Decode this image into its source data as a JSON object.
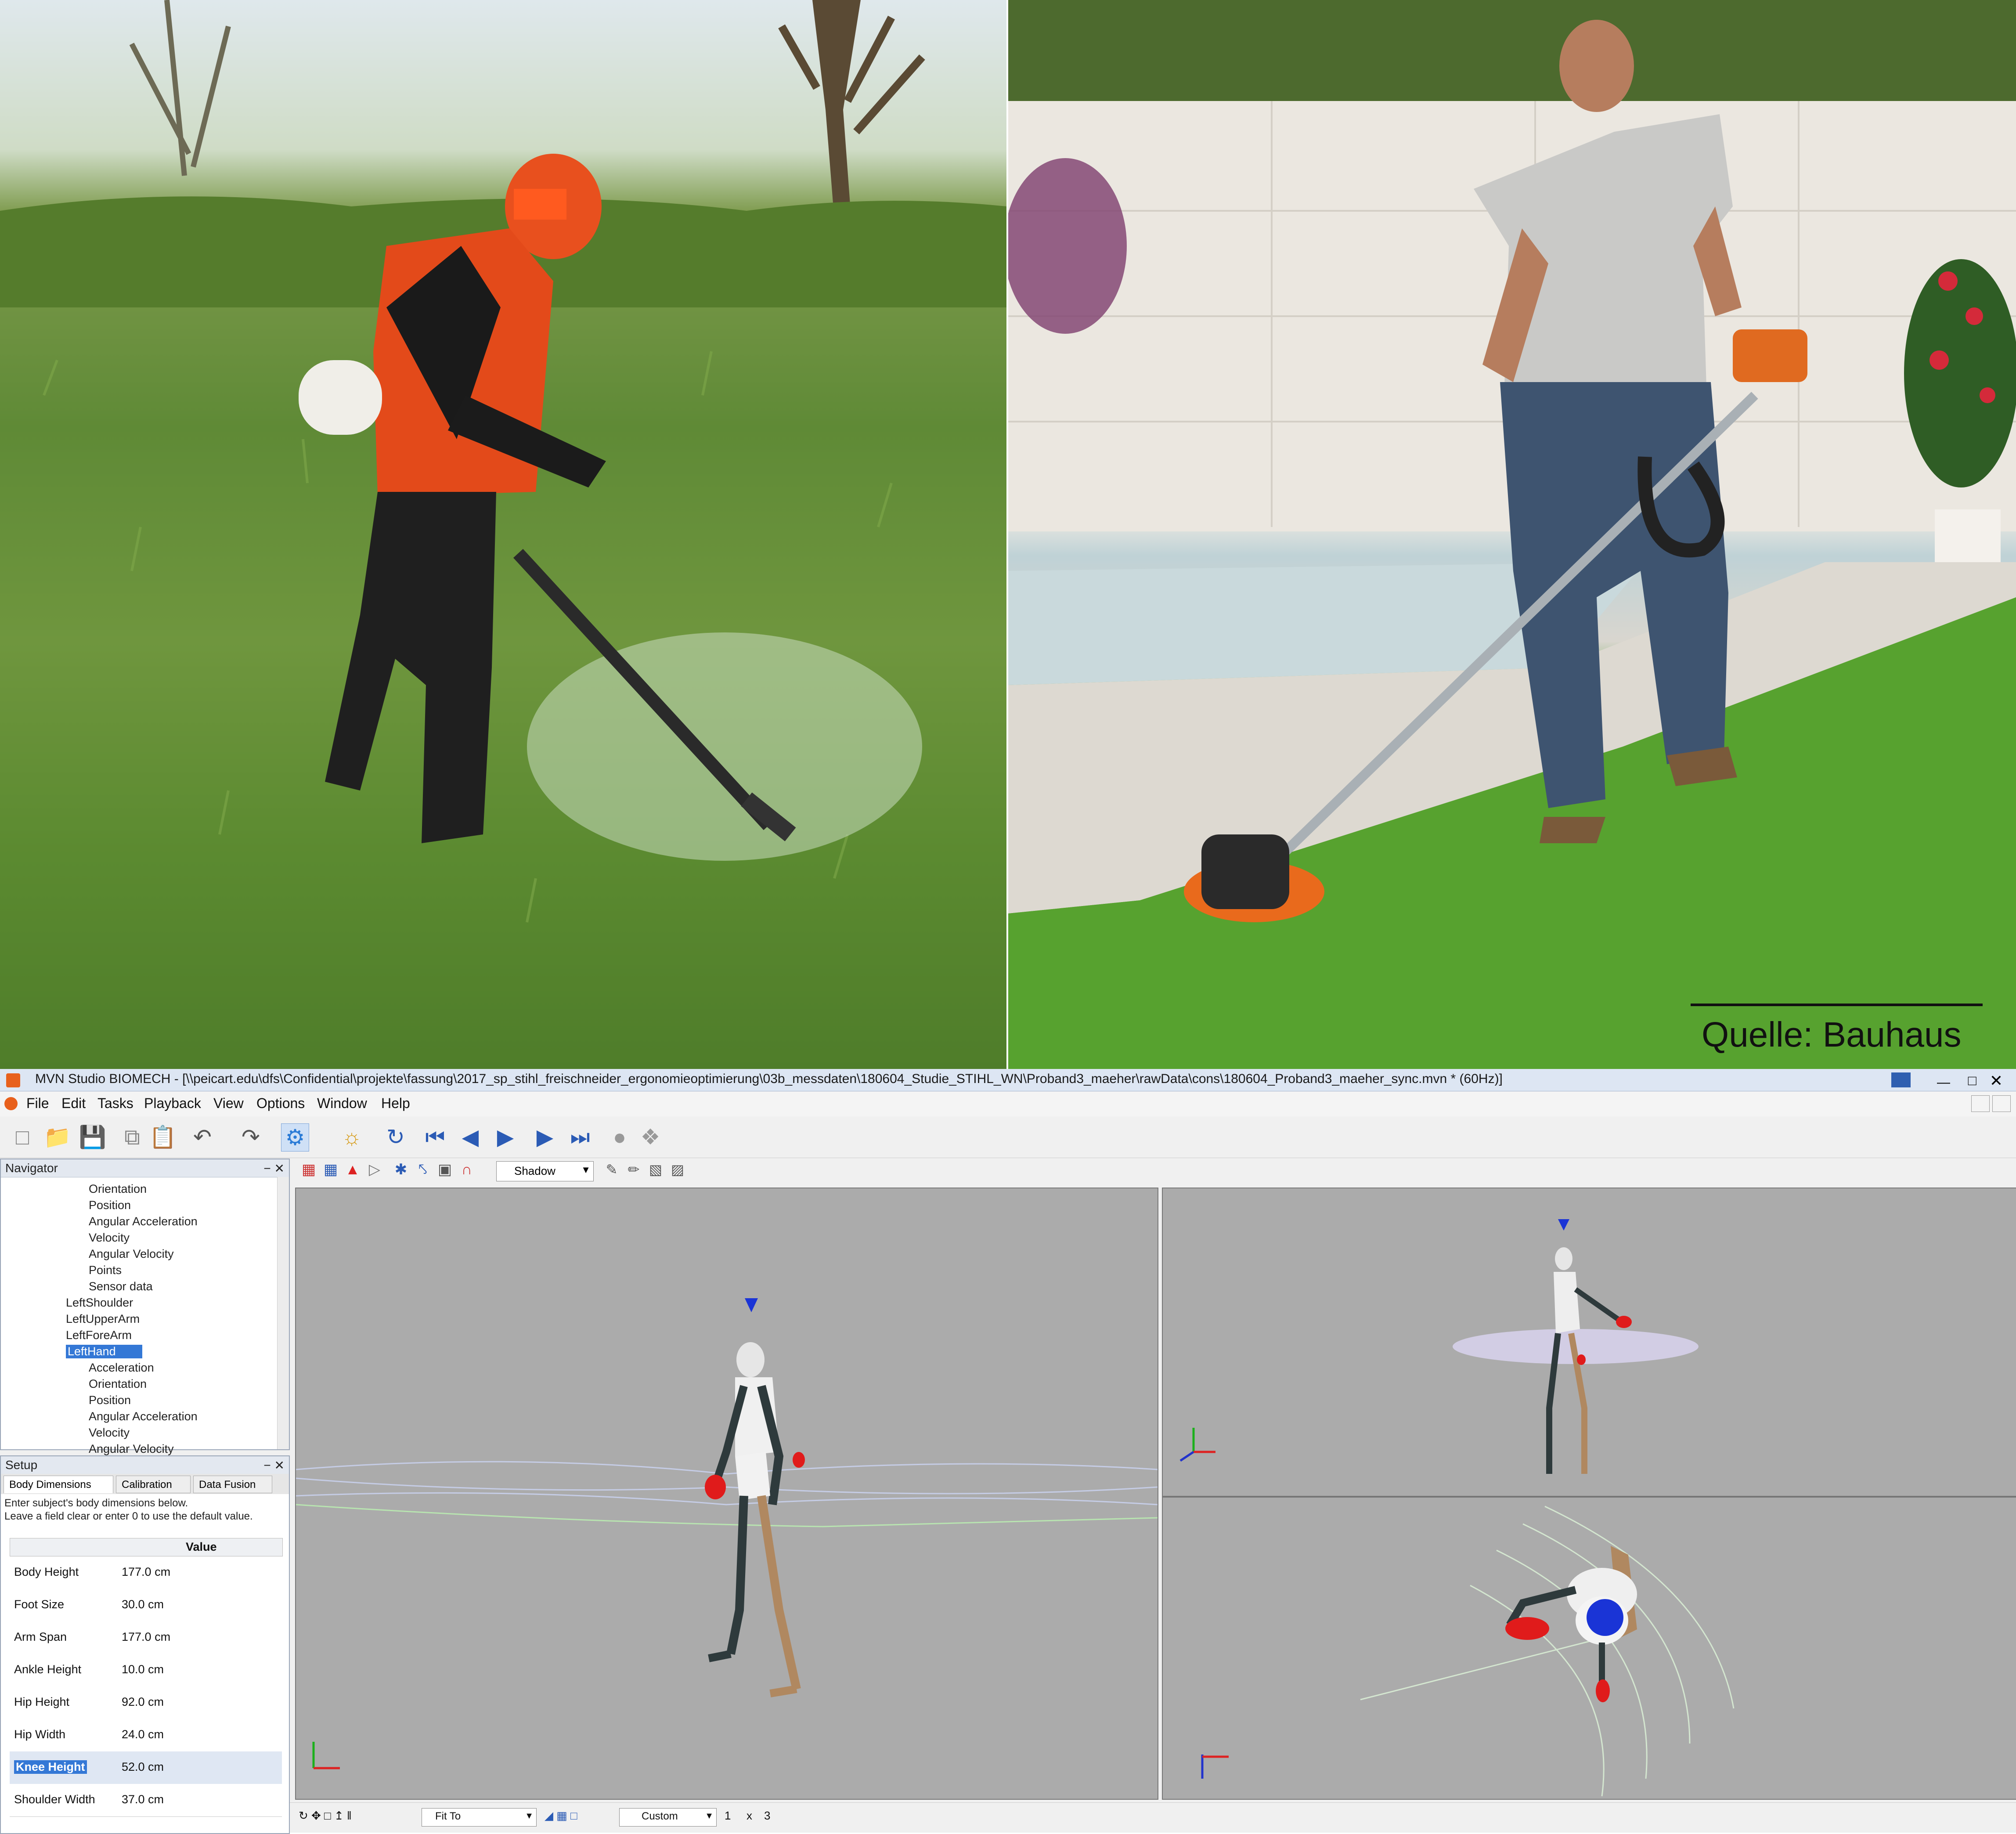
{
  "photos": {
    "left": {
      "subject": "worker with brushcutter on meadow"
    },
    "right": {
      "subject": "man with cordless grass trimmer on lawn",
      "source": "Quelle: Bauhaus"
    }
  },
  "app": {
    "title": "MVN Studio BIOMECH - [\\\\peicart.edu\\dfs\\Confidential\\projekte\\fassung\\2017_sp_stihl_freischneider_ergonomieoptimierung\\03b_messdaten\\180604_Studie_STIHL_WN\\Proband3_maeher\\rawData\\cons\\180604_Proband3_maeher_sync.mvn * (60Hz)]",
    "menu": [
      "File",
      "Edit",
      "Tasks",
      "Playback",
      "View",
      "Options",
      "Window",
      "Help"
    ],
    "toolbar2_dropdown": "Shadow",
    "navigator": {
      "title": "Navigator",
      "items": [
        {
          "label": "Orientation",
          "indent": 2,
          "selected": false
        },
        {
          "label": "Position",
          "indent": 2,
          "selected": false
        },
        {
          "label": "Angular Acceleration",
          "indent": 2,
          "selected": false
        },
        {
          "label": "Velocity",
          "indent": 2,
          "selected": false
        },
        {
          "label": "Angular Velocity",
          "indent": 2,
          "selected": false
        },
        {
          "label": "Points",
          "indent": 2,
          "selected": false
        },
        {
          "label": "Sensor data",
          "indent": 2,
          "selected": false
        },
        {
          "label": "LeftShoulder",
          "indent": 1,
          "selected": false
        },
        {
          "label": "LeftUpperArm",
          "indent": 1,
          "selected": false
        },
        {
          "label": "LeftForeArm",
          "indent": 1,
          "selected": false
        },
        {
          "label": "LeftHand",
          "indent": 1,
          "selected": true
        },
        {
          "label": "Acceleration",
          "indent": 2,
          "selected": false
        },
        {
          "label": "Orientation",
          "indent": 2,
          "selected": false
        },
        {
          "label": "Position",
          "indent": 2,
          "selected": false
        },
        {
          "label": "Angular Acceleration",
          "indent": 2,
          "selected": false
        },
        {
          "label": "Velocity",
          "indent": 2,
          "selected": false
        },
        {
          "label": "Angular Velocity",
          "indent": 2,
          "selected": false
        }
      ]
    },
    "setup": {
      "title": "Setup",
      "tabs": [
        "Body Dimensions",
        "Calibration",
        "Data Fusion"
      ],
      "active_tab": 0,
      "description": [
        "Enter subject's body dimensions below.",
        "Leave a field clear or enter 0 to use the default value."
      ],
      "column_header": "Value",
      "rows": [
        {
          "label": "Body Height",
          "value": "177.0 cm",
          "selected": false
        },
        {
          "label": "Foot Size",
          "value": "30.0 cm",
          "selected": false
        },
        {
          "label": "Arm Span",
          "value": "177.0 cm",
          "selected": false
        },
        {
          "label": "Ankle Height",
          "value": "10.0 cm",
          "selected": false
        },
        {
          "label": "Hip Height",
          "value": "92.0 cm",
          "selected": false
        },
        {
          "label": "Hip Width",
          "value": "24.0 cm",
          "selected": false
        },
        {
          "label": "Knee Height",
          "value": "52.0 cm",
          "selected": true
        },
        {
          "label": "Shoulder Width",
          "value": "37.0 cm",
          "selected": false
        }
      ]
    },
    "status": {
      "zoom": "Fit To",
      "view": "Custom",
      "page": "1",
      "sep": "x",
      "page2": "3"
    },
    "colors": {
      "viewport_bg": "#ababab",
      "accent": "#3478d6",
      "hand_marker": "#e01b1b",
      "head_marker": "#1a34d6"
    }
  }
}
